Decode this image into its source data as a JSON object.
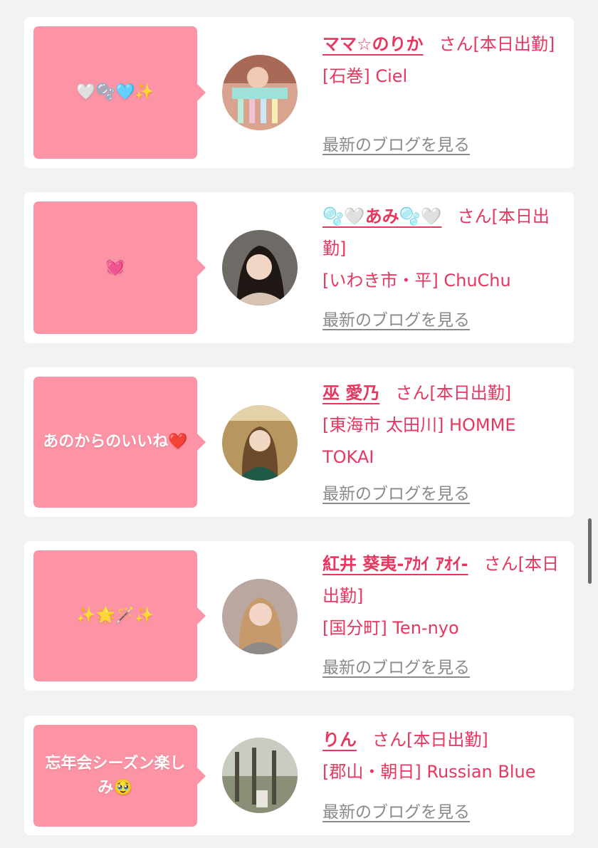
{
  "posts": [
    {
      "bubble_text": "🤍🫧🩵✨",
      "name": "ママ☆のりか",
      "suffix": "さん[本日出勤]",
      "shop": "[石巻] Ciel",
      "blog_link": "最新のブログを見る"
    },
    {
      "bubble_text": "💓",
      "name": "🫧🤍あみ🫧🤍",
      "suffix": "さん[本日出勤]",
      "shop": "[いわき市・平] ChuChu",
      "blog_link": "最新のブログを見る"
    },
    {
      "bubble_text": "あのからのいいね❤️",
      "name": "巫 愛乃",
      "suffix": "さん[本日出勤]",
      "shop": "[東海市 太田川] HOMME TOKAI",
      "blog_link": "最新のブログを見る"
    },
    {
      "bubble_text": "✨🌟🪄✨",
      "name": "紅井 葵夷-ｱｶｲ ｱｵｲ-",
      "suffix": "さん[本日出勤]",
      "shop": "[国分町] Ten-nyo",
      "blog_link": "最新のブログを見る"
    },
    {
      "bubble_text": "忘年会シーズン楽しみ🥹",
      "name": "りん",
      "suffix": "さん[本日出勤]",
      "shop": "[郡山・朝日] Russian Blue",
      "blog_link": "最新のブログを見る"
    }
  ],
  "colors": {
    "bubble": "#fd94a6",
    "accent": "#e8365f",
    "link": "#8a8a8a"
  }
}
